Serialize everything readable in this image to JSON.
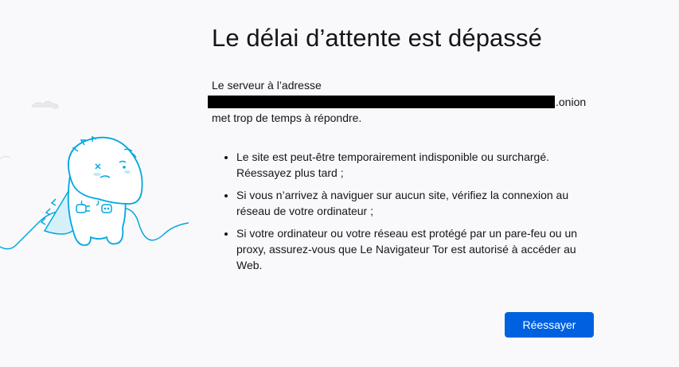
{
  "error": {
    "title": "Le délai d’attente est dépassé",
    "server_prefix": "Le serveur à l’adresse",
    "onion_suffix": ".onion",
    "server_suffix": "met trop de temps à répondre.",
    "tips": [
      "Le site est peut-être temporairement indisponible ou surchargé. Réessayez plus tard ;",
      "Si vous n’arrivez à naviguer sur aucun site, vérifiez la connexion au réseau de votre ordinateur ;",
      "Si votre ordinateur ou votre réseau est protégé par un pare-feu ou un proxy, assurez-vous que Le Navigateur Tor est autorisé à accéder au Web."
    ],
    "retry_label": "Réessayer"
  },
  "colors": {
    "accent": "#0061e0",
    "illustration_stroke": "#00a8e0",
    "illustration_fill": "#e0f4fb",
    "background": "#f9f9fb"
  }
}
